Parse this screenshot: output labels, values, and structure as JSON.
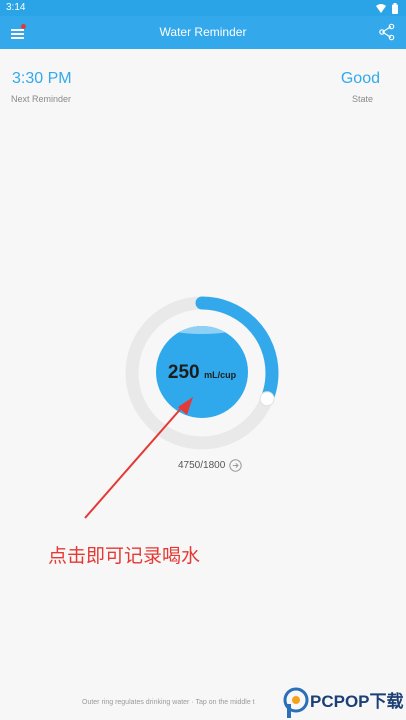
{
  "status_bar": {
    "time": "3:14"
  },
  "app_bar": {
    "title": "Water Reminder"
  },
  "next_reminder": {
    "time": "3:30 PM",
    "label": "Next Reminder"
  },
  "state": {
    "value": "Good",
    "label": "State"
  },
  "cup": {
    "amount": "250",
    "unit": "mL/cup"
  },
  "progress": {
    "text": "4750/1800",
    "ring_fraction": 0.31
  },
  "annotation": {
    "text": "点击即可记录喝水"
  },
  "footer": {
    "hint": "Outer ring regulates drinking water · Tap on the middle t"
  },
  "watermark": {
    "text": "PCPOP下载"
  },
  "colors": {
    "primary": "#33a9ec",
    "accent": "#e53935",
    "ring_track": "#e9e9e9"
  },
  "icons": [
    "menu-icon",
    "share-icon",
    "wifi-icon",
    "battery-icon",
    "arrow-right-circle-icon"
  ]
}
